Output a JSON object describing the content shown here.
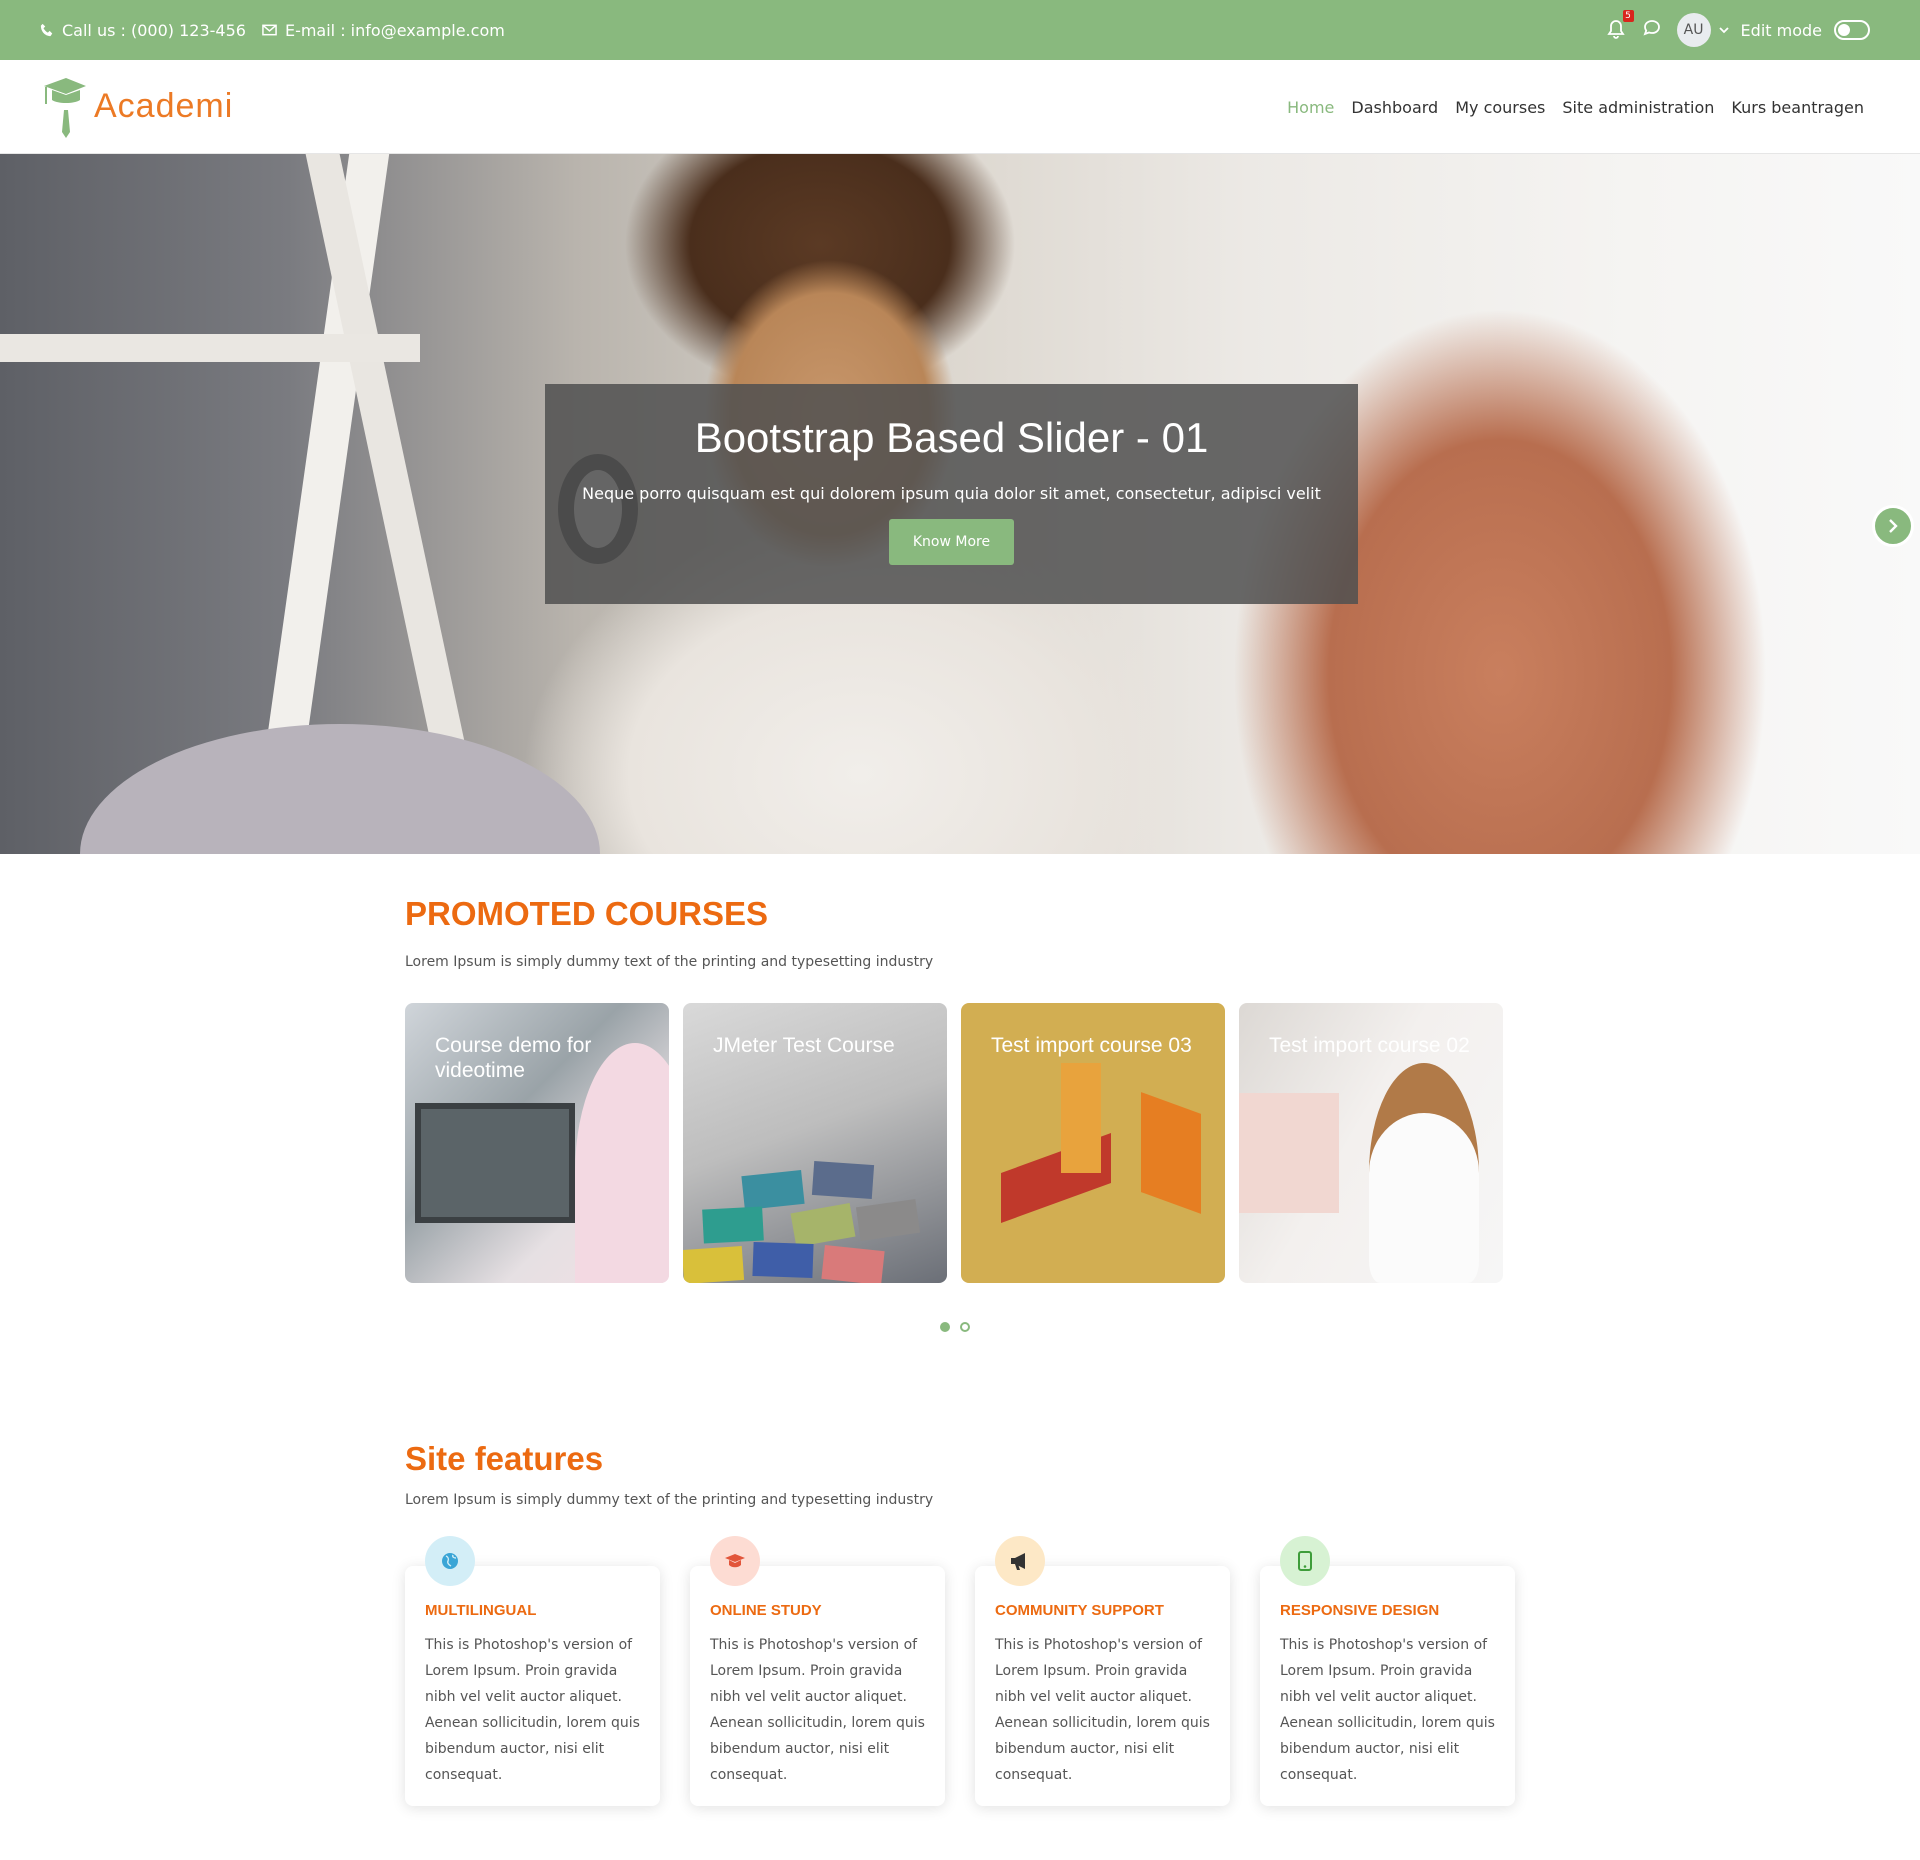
{
  "topbar": {
    "call_label": "Call us : (000) 123-456",
    "email_label": "E-mail : info@example.com",
    "notification_count": "5",
    "avatar_initials": "AU",
    "edit_mode_label": "Edit mode",
    "edit_mode_on": false
  },
  "brand": {
    "name": "Academi"
  },
  "nav": {
    "items": [
      {
        "label": "Home",
        "active": true
      },
      {
        "label": "Dashboard"
      },
      {
        "label": "My courses"
      },
      {
        "label": "Site administration"
      },
      {
        "label": "Kurs beantragen"
      }
    ]
  },
  "slider": {
    "title": "Bootstrap Based Slider - 01",
    "text": "Neque porro quisquam est qui dolorem ipsum quia dolor sit amet, consectetur, adipisci velit",
    "button_label": "Know More"
  },
  "promoted": {
    "title": "PROMOTED COURSES",
    "subtitle": "Lorem Ipsum is simply dummy text of the printing and typesetting industry",
    "courses": [
      {
        "title": "Course demo for videotime"
      },
      {
        "title": "JMeter Test Course"
      },
      {
        "title": "Test import course 03"
      },
      {
        "title": "Test import course 02"
      }
    ],
    "pages": 2,
    "current_page": 1
  },
  "features": {
    "title": "Site features",
    "subtitle": "Lorem Ipsum is simply dummy text of the printing and typesetting industry",
    "items": [
      {
        "title": "MULTILINGUAL",
        "icon": "globe-icon",
        "icon_bg": "#d3eef7",
        "icon_color": "#3aa5d6",
        "text": "This is Photoshop's version of Lorem Ipsum. Proin gravida nibh vel velit auctor aliquet. Aenean sollicitudin, lorem quis bibendum auctor, nisi elit consequat."
      },
      {
        "title": "ONLINE STUDY",
        "icon": "graduation-cap-icon",
        "icon_bg": "#fddcd3",
        "icon_color": "#e2553a",
        "text": "This is Photoshop's version of Lorem Ipsum. Proin gravida nibh vel velit auctor aliquet. Aenean sollicitudin, lorem quis bibendum auctor, nisi elit consequat."
      },
      {
        "title": "COMMUNITY SUPPORT",
        "icon": "megaphone-icon",
        "icon_bg": "#fde8c6",
        "icon_color": "#333333",
        "text": "This is Photoshop's version of Lorem Ipsum. Proin gravida nibh vel velit auctor aliquet. Aenean sollicitudin, lorem quis bibendum auctor, nisi elit consequat."
      },
      {
        "title": "RESPONSIVE DESIGN",
        "icon": "mobile-icon",
        "icon_bg": "#d7f2d3",
        "icon_color": "#3e9d3a",
        "text": "This is Photoshop's version of Lorem Ipsum. Proin gravida nibh vel velit auctor aliquet. Aenean sollicitudin, lorem quis bibendum auctor, nisi elit consequat."
      }
    ]
  },
  "colors": {
    "accent_green": "#89b97e",
    "accent_orange": "#ec6a11",
    "badge_red": "#d9251d"
  }
}
